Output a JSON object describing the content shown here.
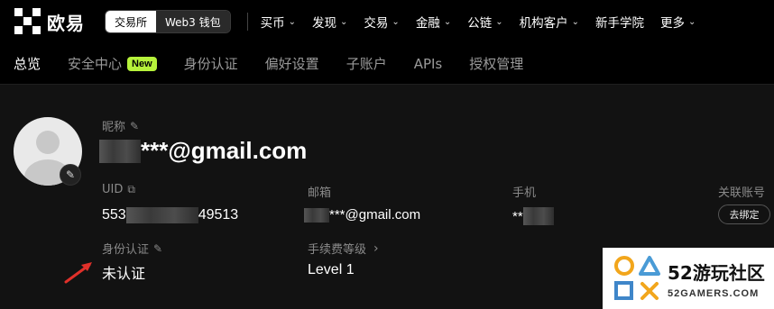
{
  "brand": {
    "name": "欧易"
  },
  "mode_toggle": {
    "exchange": "交易所",
    "web3": "Web3 钱包"
  },
  "nav": [
    {
      "label": "买币",
      "has_dropdown": true
    },
    {
      "label": "发现",
      "has_dropdown": true
    },
    {
      "label": "交易",
      "has_dropdown": true
    },
    {
      "label": "金融",
      "has_dropdown": true
    },
    {
      "label": "公链",
      "has_dropdown": true
    },
    {
      "label": "机构客户",
      "has_dropdown": true
    },
    {
      "label": "新手学院",
      "has_dropdown": false
    },
    {
      "label": "更多",
      "has_dropdown": true
    }
  ],
  "tabs": [
    {
      "label": "总览",
      "active": true
    },
    {
      "label": "安全中心",
      "badge": "New"
    },
    {
      "label": "身份认证"
    },
    {
      "label": "偏好设置"
    },
    {
      "label": "子账户"
    },
    {
      "label": "APIs"
    },
    {
      "label": "授权管理"
    }
  ],
  "profile": {
    "nickname_label": "昵称",
    "nickname_value": "***@gmail.com",
    "uid_label": "UID",
    "uid_prefix": "553",
    "uid_suffix": "49513",
    "email_label": "邮箱",
    "email_value": "***@gmail.com",
    "phone_label": "手机",
    "phone_value": "**",
    "linked_label": "关联账号",
    "unbind_label": "去绑定",
    "kyc_label": "身份认证",
    "kyc_value": "未认证",
    "fee_label": "手续费等级",
    "fee_value": "Level 1"
  },
  "watermark": {
    "title": "52游玩社区",
    "subtitle": "52GAMERS.COM"
  },
  "colors": {
    "accent_new": "#b6f23b",
    "arrow": "#e0302a"
  }
}
